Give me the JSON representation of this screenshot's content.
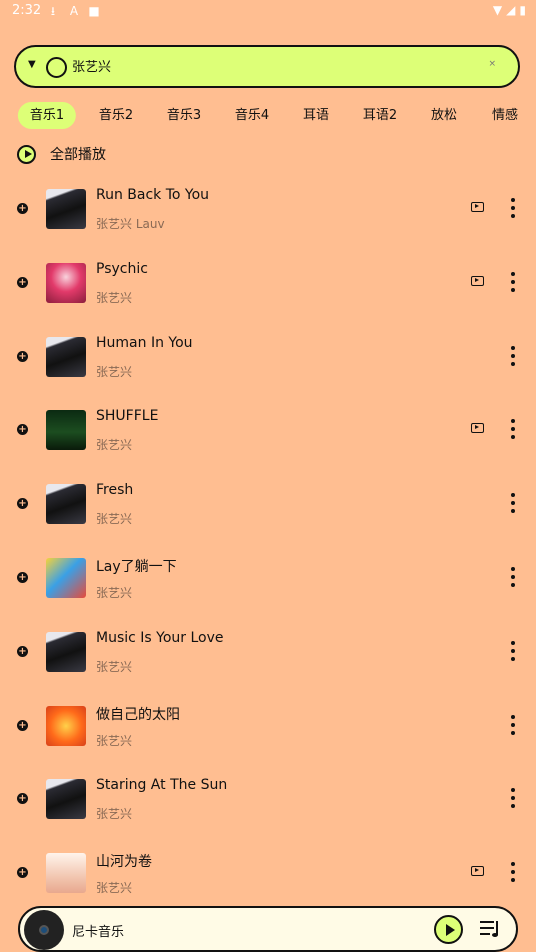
{
  "status_bar": {
    "time": "2:32"
  },
  "search": {
    "value": "张艺兴",
    "clear_symbol": "×"
  },
  "tabs": [
    "音乐1",
    "音乐2",
    "音乐3",
    "音乐4",
    "耳语",
    "耳语2",
    "放松",
    "情感"
  ],
  "active_tab": 0,
  "play_all_label": "全部播放",
  "songs": [
    {
      "title": "Run Back To You",
      "artist": "张艺兴 Lauv",
      "has_mv": true,
      "cover": "portrait-dark"
    },
    {
      "title": "Psychic",
      "artist": "张艺兴",
      "has_mv": true,
      "cover": "psychic-red"
    },
    {
      "title": "Human In You",
      "artist": "张艺兴",
      "has_mv": false,
      "cover": "portrait-dark"
    },
    {
      "title": "SHUFFLE",
      "artist": "张艺兴",
      "has_mv": true,
      "cover": "shuffle-green"
    },
    {
      "title": "Fresh",
      "artist": "张艺兴",
      "has_mv": false,
      "cover": "portrait-dark"
    },
    {
      "title": "Lay了躺一下",
      "artist": "张艺兴",
      "has_mv": false,
      "cover": "colorful-yellow"
    },
    {
      "title": "Music Is Your Love",
      "artist": "张艺兴",
      "has_mv": false,
      "cover": "portrait-dark"
    },
    {
      "title": "做自己的太阳",
      "artist": "张艺兴",
      "has_mv": false,
      "cover": "sun-orange"
    },
    {
      "title": "Staring At The Sun",
      "artist": "张艺兴",
      "has_mv": false,
      "cover": "portrait-dark"
    },
    {
      "title": "山河为卷",
      "artist": "张艺兴",
      "has_mv": true,
      "cover": "white-portrait"
    }
  ],
  "player": {
    "title": "尼卡音乐"
  },
  "colors": {
    "background": "#FFBE91",
    "accent": "#DDFF77",
    "artist_text": "#8a6a55"
  }
}
